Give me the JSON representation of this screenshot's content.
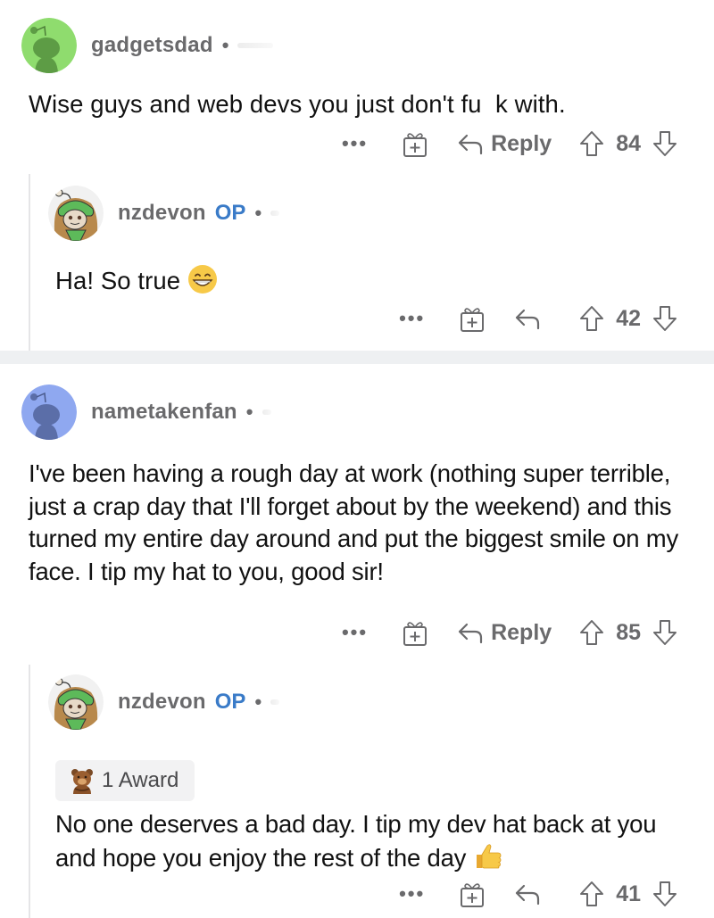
{
  "comments": [
    {
      "username": "gadgetsdad",
      "is_op": false,
      "avatar": "snoo-avatar-green",
      "avatar_color": "#8fdc6e",
      "body": "Wise guys and web devs you just don't fu  k with.",
      "actions": {
        "more": "•••",
        "gift": "gift-icon",
        "reply_label": "Reply",
        "score": "84"
      }
    },
    {
      "username": "nzdevon",
      "is_op": true,
      "op_label": "OP",
      "avatar": "frog-hood-avatar",
      "body": "Ha! So true",
      "body_emoji": "😁",
      "actions": {
        "more": "•••",
        "gift": "gift-icon",
        "reply_label": "",
        "score": "42"
      }
    },
    {
      "username": "nametakenfan",
      "is_op": false,
      "avatar": "snoo-avatar-blue",
      "avatar_color": "#8fa8f0",
      "body": "I've been having a rough day at work (nothing super terrible, just a crap day that I'll forget about by the weekend) and this turned my entire day around and put the biggest smile on my face. I tip my hat to you, good sir!",
      "actions": {
        "more": "•••",
        "gift": "gift-icon",
        "reply_label": "Reply",
        "score": "85"
      }
    },
    {
      "username": "nzdevon",
      "is_op": true,
      "op_label": "OP",
      "avatar": "frog-hood-avatar",
      "award": {
        "icon": "bear-award-icon",
        "label": "1 Award"
      },
      "body": "No one deserves a bad day. I tip my dev hat back at you and hope you enjoy the rest of the day",
      "body_emoji": "👍",
      "actions": {
        "more": "•••",
        "gift": "gift-icon",
        "reply_label": "",
        "score": "41"
      }
    }
  ],
  "separator_dot": "•",
  "colors": {
    "op": "#3a7bc8",
    "meta": "#6a6a6c",
    "separator": "#eef0f2",
    "thread_line": "#e5e5e7"
  }
}
